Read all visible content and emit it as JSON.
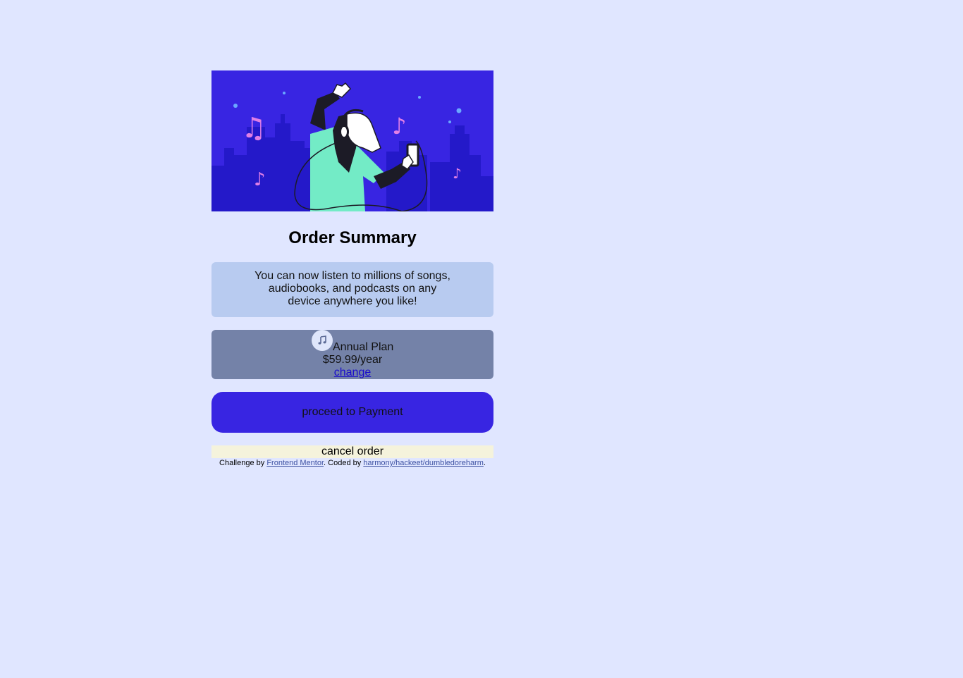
{
  "hero": {
    "alt": "illustration of a person dancing with headphones in a city at night"
  },
  "title": "Order Summary",
  "description": {
    "line1": "You can now listen to millions of songs,",
    "line2": "audiobooks, and podcasts on any",
    "line3": "device anywhere you like!"
  },
  "plan": {
    "icon": "music-note-icon",
    "name": "Annual Plan",
    "price": "$59.99/year",
    "change_label": "change"
  },
  "actions": {
    "proceed_label": "proceed to Payment",
    "cancel_label": "cancel order"
  },
  "attribution": {
    "prefix": "Challenge by ",
    "challenge_link": "Frontend Mentor",
    "middle": ". Coded by ",
    "author_link": "harmony/hackeet/dumbledoreharm",
    "suffix": "."
  },
  "colors": {
    "page_background": "#e0e6ff",
    "hero_background": "#3825e2",
    "description_background": "#b8cbf0",
    "plan_background": "#7482a8",
    "proceed_button": "#3825e2",
    "cancel_button": "#f5f3dc"
  }
}
